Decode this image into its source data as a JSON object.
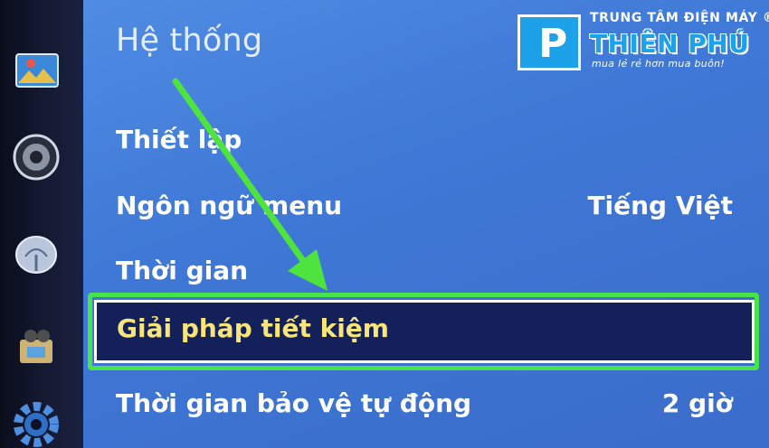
{
  "panel": {
    "title": "Hệ thống",
    "items": [
      {
        "label": "Thiết lập",
        "value": ""
      },
      {
        "label": "Ngôn ngữ menu",
        "value": "Tiếng Việt"
      },
      {
        "label": "Thời gian",
        "value": ""
      },
      {
        "label": "Giải pháp tiết kiệm",
        "value": "",
        "selected": true
      },
      {
        "label": "Thời gian bảo vệ tự động",
        "value": "2 giờ"
      }
    ]
  },
  "sidebar": {
    "icons": [
      "picture-icon",
      "sound-icon",
      "broadcast-icon",
      "app-icon",
      "settings-gear-icon"
    ]
  },
  "logo": {
    "top_text": "TRUNG TÂM ĐIỆN MÁY ®",
    "main_text": "THIÊN PHÚ",
    "slogan": "mua lẻ rẻ hơn mua buôn!"
  },
  "colors": {
    "panel_blue": "#4a84de",
    "selected_bg": "#13205a",
    "selected_text": "#f7e57a",
    "highlight_green": "#48e24b",
    "logo_blue": "#1da1e8"
  }
}
